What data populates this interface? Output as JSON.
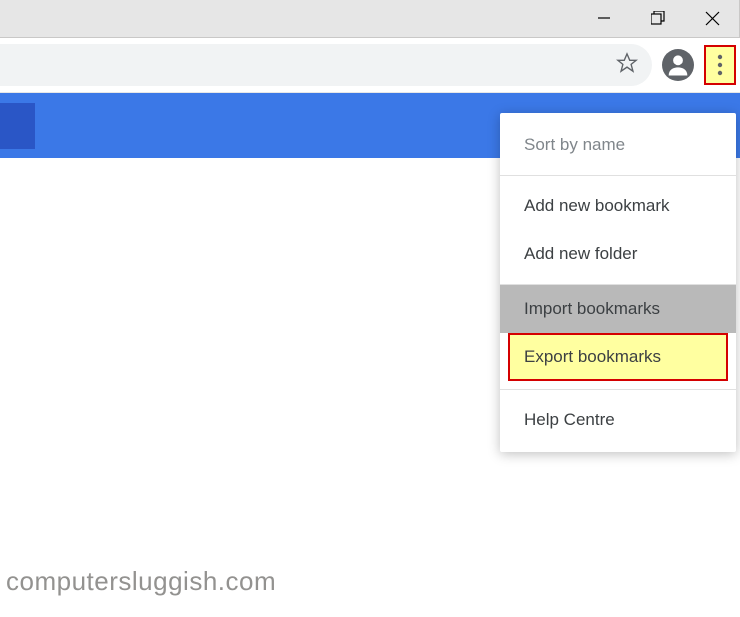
{
  "menu": {
    "sort_by_name": "Sort by name",
    "add_new_bookmark": "Add new bookmark",
    "add_new_folder": "Add new folder",
    "import_bookmarks": "Import bookmarks",
    "export_bookmarks": "Export bookmarks",
    "help_centre": "Help Centre"
  },
  "watermark": "computersluggish.com"
}
